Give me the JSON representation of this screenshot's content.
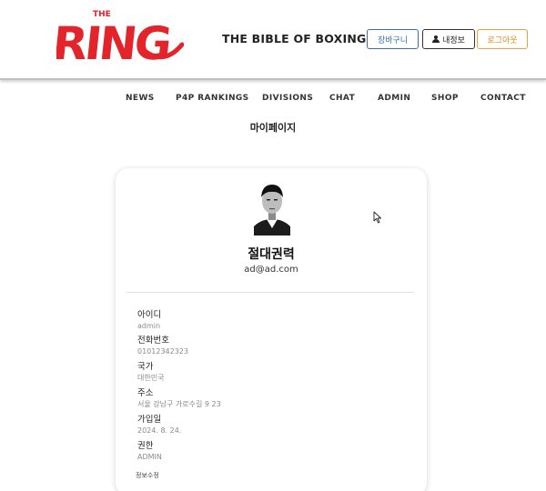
{
  "header": {
    "logo_small_text": "THE",
    "logo_text": "RING",
    "tagline": "THE BIBLE OF BOXING",
    "buttons": {
      "cart": "장바구니",
      "my_info": "내정보",
      "logout": "로그아웃"
    }
  },
  "nav": {
    "items": [
      "NEWS",
      "P4P RANKINGS",
      "DIVISIONS",
      "CHAT",
      "ADMIN",
      "SHOP",
      "CONTACT"
    ]
  },
  "page": {
    "title": "마이페이지"
  },
  "profile": {
    "name": "절대권력",
    "email": "ad@ad.com",
    "fields": [
      {
        "label": "아이디",
        "value": "admin"
      },
      {
        "label": "전화번호",
        "value": "01012342323"
      },
      {
        "label": "국가",
        "value": "대한민국"
      },
      {
        "label": "주소",
        "value": "서울 강남구 가로수길 9 23"
      },
      {
        "label": "가입일",
        "value": "2024. 8. 24."
      },
      {
        "label": "권한",
        "value": "ADMIN"
      }
    ],
    "edit_label": "정보수정"
  },
  "colors": {
    "brand_red": "#e3242b",
    "cart_blue": "#3a6fb0",
    "logout_orange": "#e08a1a"
  }
}
